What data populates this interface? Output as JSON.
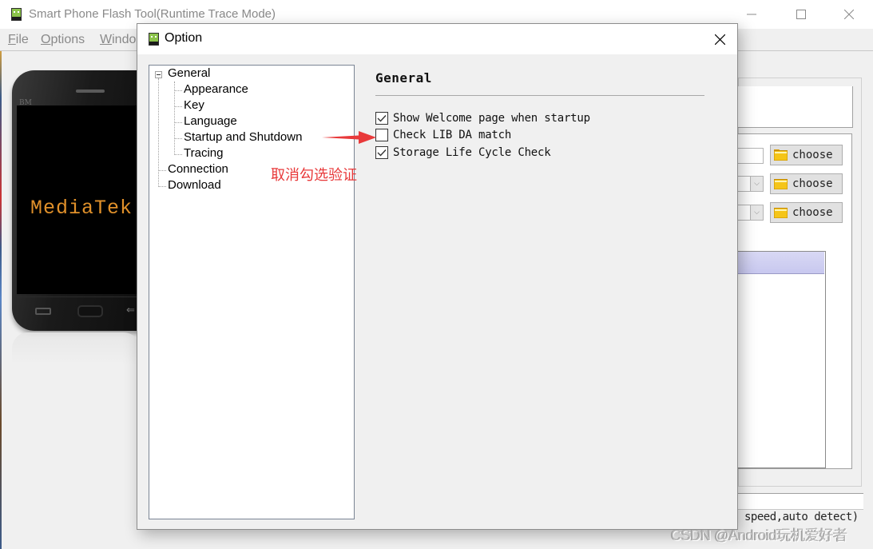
{
  "main_window": {
    "title": "Smart Phone Flash Tool(Runtime Trace Mode)",
    "icon": "android-app-icon",
    "controls": {
      "minimize": "minimize-icon",
      "maximize": "maximize-icon",
      "close": "close-icon"
    },
    "menu": [
      {
        "accel": "F",
        "rest": "ile"
      },
      {
        "accel": "O",
        "rest": "ptions"
      },
      {
        "accel": "W",
        "rest": "indo"
      }
    ],
    "phone_preview": {
      "brand": "BM",
      "screen_text": "MediaTek"
    },
    "right_panel": {
      "choose_buttons": [
        "choose",
        "choose",
        "choose"
      ],
      "status_text": "speed,auto detect)"
    }
  },
  "dialog": {
    "title": "Option",
    "icon": "android-app-icon",
    "tree": {
      "items": [
        {
          "label": "General",
          "level": 0,
          "expanded": true
        },
        {
          "label": "Appearance",
          "level": 1
        },
        {
          "label": "Key",
          "level": 1
        },
        {
          "label": "Language",
          "level": 1
        },
        {
          "label": "Startup and Shutdown",
          "level": 1
        },
        {
          "label": "Tracing",
          "level": 1
        },
        {
          "label": "Connection",
          "level": 0
        },
        {
          "label": "Download",
          "level": 0
        }
      ]
    },
    "section_title": "General",
    "options": [
      {
        "label": "Show Welcome page when startup",
        "checked": true
      },
      {
        "label": "Check LIB DA match",
        "checked": false
      },
      {
        "label": "Storage Life Cycle Check",
        "checked": true
      }
    ]
  },
  "annotation": {
    "text": "取消勾选验证",
    "color": "#e8393a"
  },
  "watermark": "CSDN @Android玩机爱好者"
}
